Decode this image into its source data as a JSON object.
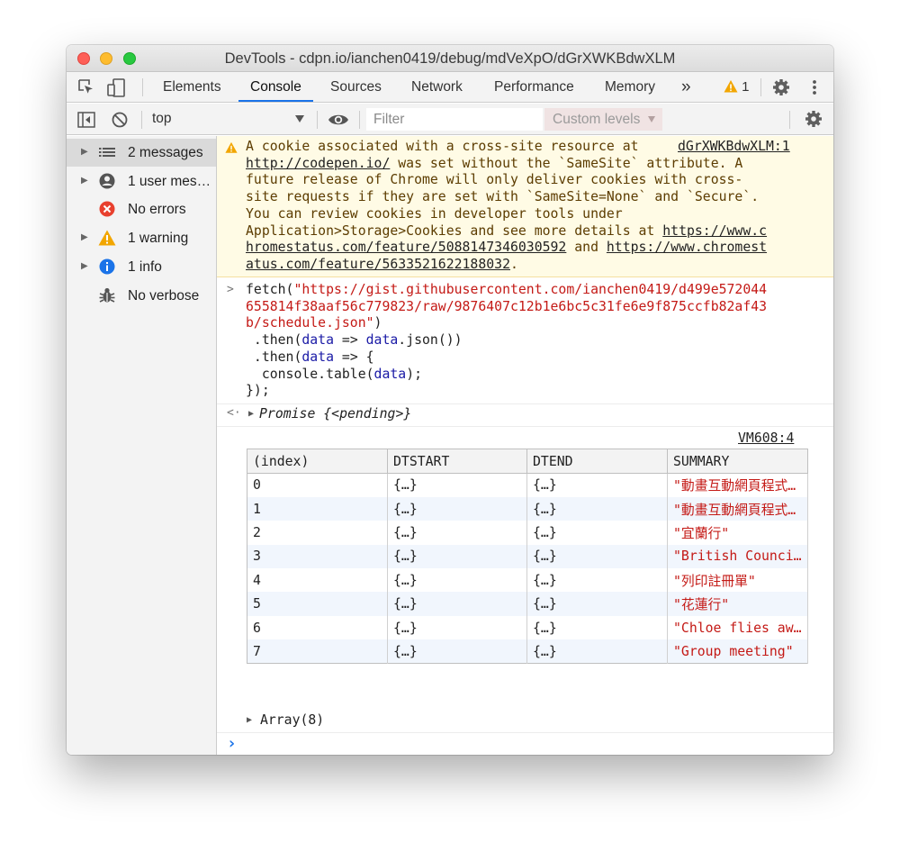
{
  "window": {
    "title": "DevTools - cdpn.io/ianchen0419/debug/mdVeXpO/dGrXWKBdwXLM"
  },
  "tabs": {
    "items": [
      "Elements",
      "Console",
      "Sources",
      "Network",
      "Performance",
      "Memory"
    ],
    "more": "»",
    "warning_count": "1"
  },
  "toolbar": {
    "context": "top",
    "filter_placeholder": "Filter",
    "levels": "Custom levels"
  },
  "sidebar": {
    "items": [
      {
        "label": "2 messages",
        "icon": "list-icon"
      },
      {
        "label": "1 user mes…",
        "icon": "user-icon"
      },
      {
        "label": "No errors",
        "icon": "error-icon"
      },
      {
        "label": "1 warning",
        "icon": "warning-icon"
      },
      {
        "label": "1 info",
        "icon": "info-icon"
      },
      {
        "label": "No verbose",
        "icon": "bug-icon"
      }
    ]
  },
  "console": {
    "warning": {
      "line1": "A cookie associated with a cross-site resource at ",
      "source": "dGrXWKBdwXLM:1",
      "link1": "http://codepen.io/",
      "line2_rest": " was set without the `SameSite` attribute. A",
      "line3": "future release of Chrome will only deliver cookies with cross-",
      "line4": "site requests if they are set with `SameSite=None` and `Secure`.",
      "line5": "You can review cookies in developer tools under",
      "line6_pre": "Application>Storage>Cookies and see more details at ",
      "link2a": "https://www.c",
      "link2b": "hromestatus.com/feature/5088147346030592",
      "and": " and ",
      "link3a": "https://www.chromest",
      "link3b": "atus.com/feature/5633521622188032",
      "end": "."
    },
    "input": {
      "l1_pre": "fetch(",
      "l1_str": "\"https://gist.githubusercontent.com/ianchen0419/d499e572044",
      "l2_str": "655814f38aaf56c779823/raw/9876407c12b1e6bc5c31fe6e9f875ccfb82af43",
      "l3_str": "b/schedule.json\"",
      "l3_post": ")",
      "l4_pre": " .then(",
      "l4_param": "data",
      "l4_mid": " => ",
      "l4_ref": "data",
      "l4_post": ".json())",
      "l5_pre": " .then(",
      "l5_param": "data",
      "l5_mid": " => {",
      "l6_pre": "  console.table(",
      "l6_ref": "data",
      "l6_post": ");",
      "l7": "});"
    },
    "result": "Promise {<pending>}",
    "table_source": "VM608:4",
    "table": {
      "headers": [
        "(index)",
        "DTSTART",
        "DTEND",
        "SUMMARY"
      ],
      "rows": [
        [
          "0",
          "{…}",
          "{…}",
          "\"動畫互動網頁程式入門（HTML/CSS/JS）\""
        ],
        [
          "1",
          "{…}",
          "{…}",
          "\"動畫互動網頁程式入門（HTML/CSS/JS）\""
        ],
        [
          "2",
          "{…}",
          "{…}",
          "\"宜蘭行\""
        ],
        [
          "3",
          "{…}",
          "{…}",
          "\"British Council\""
        ],
        [
          "4",
          "{…}",
          "{…}",
          "\"列印註冊單\""
        ],
        [
          "5",
          "{…}",
          "{…}",
          "\"花蓮行\""
        ],
        [
          "6",
          "{…}",
          "{…}",
          "\"Chloe flies away\""
        ],
        [
          "7",
          "{…}",
          "{…}",
          "\"Group meeting\""
        ]
      ]
    },
    "array_label": "Array(8)",
    "prompt": "›"
  },
  "colors": {
    "accent": "#1a73e8",
    "string": "#c41a16",
    "warning_bg": "#fffbe5",
    "warning_text": "#5c3c00"
  }
}
